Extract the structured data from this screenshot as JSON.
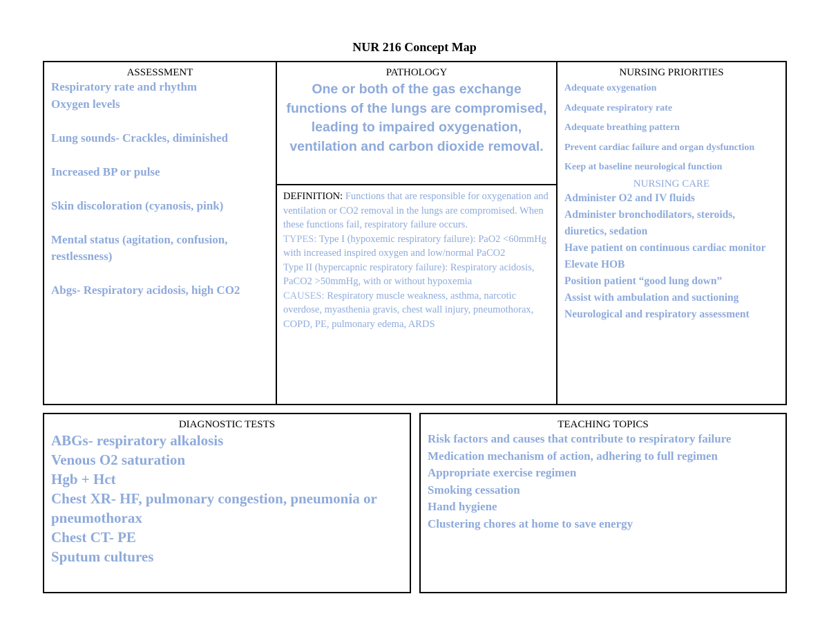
{
  "title": "NUR 216 Concept Map",
  "colors": {
    "accent_text": "#8eaadb",
    "heading_text": "#000000",
    "border": "#000000"
  },
  "assessment": {
    "header": "ASSESSMENT",
    "items": [
      "Respiratory rate and rhythm",
      "Oxygen levels",
      "",
      "Lung sounds- Crackles, diminished",
      "",
      "Increased BP or pulse",
      "",
      "Skin discoloration (cyanosis, pink)",
      "",
      "Mental status (agitation, confusion, restlessness)",
      "",
      "Abgs- Respiratory acidosis, high CO2"
    ]
  },
  "pathology": {
    "header": "PATHOLOGY",
    "body": "One or both of the gas exchange functions of the lungs are compromised, leading to impaired oxygenation, ventilation and carbon dioxide removal.",
    "definition_label": "DEFINITION:",
    "definition_text": " Functions that are responsible for oxygenation and ventilation or CO2 removal in the lungs are compromised. When these functions fail, respiratory failure occurs.",
    "types_label": "TYPES:",
    "type1_text": " Type I (hypoxemic respiratory failure): PaO2 <60mmHg with increased inspired oxygen and low/normal PaCO2",
    "type2_text": "Type II (hypercapnic respiratory failure): Respiratory acidosis, PaCO2 >50mmHg, with or without hypoxemia",
    "causes_label": "CAUSES:",
    "causes_text": " Respiratory muscle weakness, asthma, narcotic overdose, myasthenia gravis, chest wall injury, pneumothorax, COPD, PE, pulmonary edema, ARDS"
  },
  "nursing_priorities": {
    "header": "NURSING PRIORITIES",
    "items": [
      "Adequate oxygenation",
      "Adequate respiratory rate",
      "Adequate breathing pattern",
      "Prevent cardiac failure and organ dysfunction",
      "Keep at baseline neurological function"
    ],
    "care_header": "NURSING CARE",
    "care_items": [
      "Administer O2 and IV fluids",
      "Administer bronchodilators, steroids, diuretics, sedation",
      "Have patient on continuous cardiac monitor",
      "Elevate HOB",
      "Position patient “good lung down”",
      "Assist with ambulation and suctioning",
      "Neurological and respiratory assessment"
    ]
  },
  "diagnostic_tests": {
    "header": "DIAGNOSTIC TESTS",
    "items": [
      "ABGs- respiratory alkalosis",
      "Venous O2 saturation",
      "Hgb + Hct",
      "Chest XR- HF, pulmonary congestion, pneumonia or pneumothorax",
      "Chest CT- PE",
      "Sputum cultures"
    ]
  },
  "teaching_topics": {
    "header": "TEACHING TOPICS",
    "items": [
      "Risk factors and causes that contribute to respiratory failure",
      "Medication mechanism of action, adhering to full regimen",
      "Appropriate exercise regimen",
      "Smoking cessation",
      "Hand hygiene",
      "Clustering chores at home to save energy"
    ]
  }
}
